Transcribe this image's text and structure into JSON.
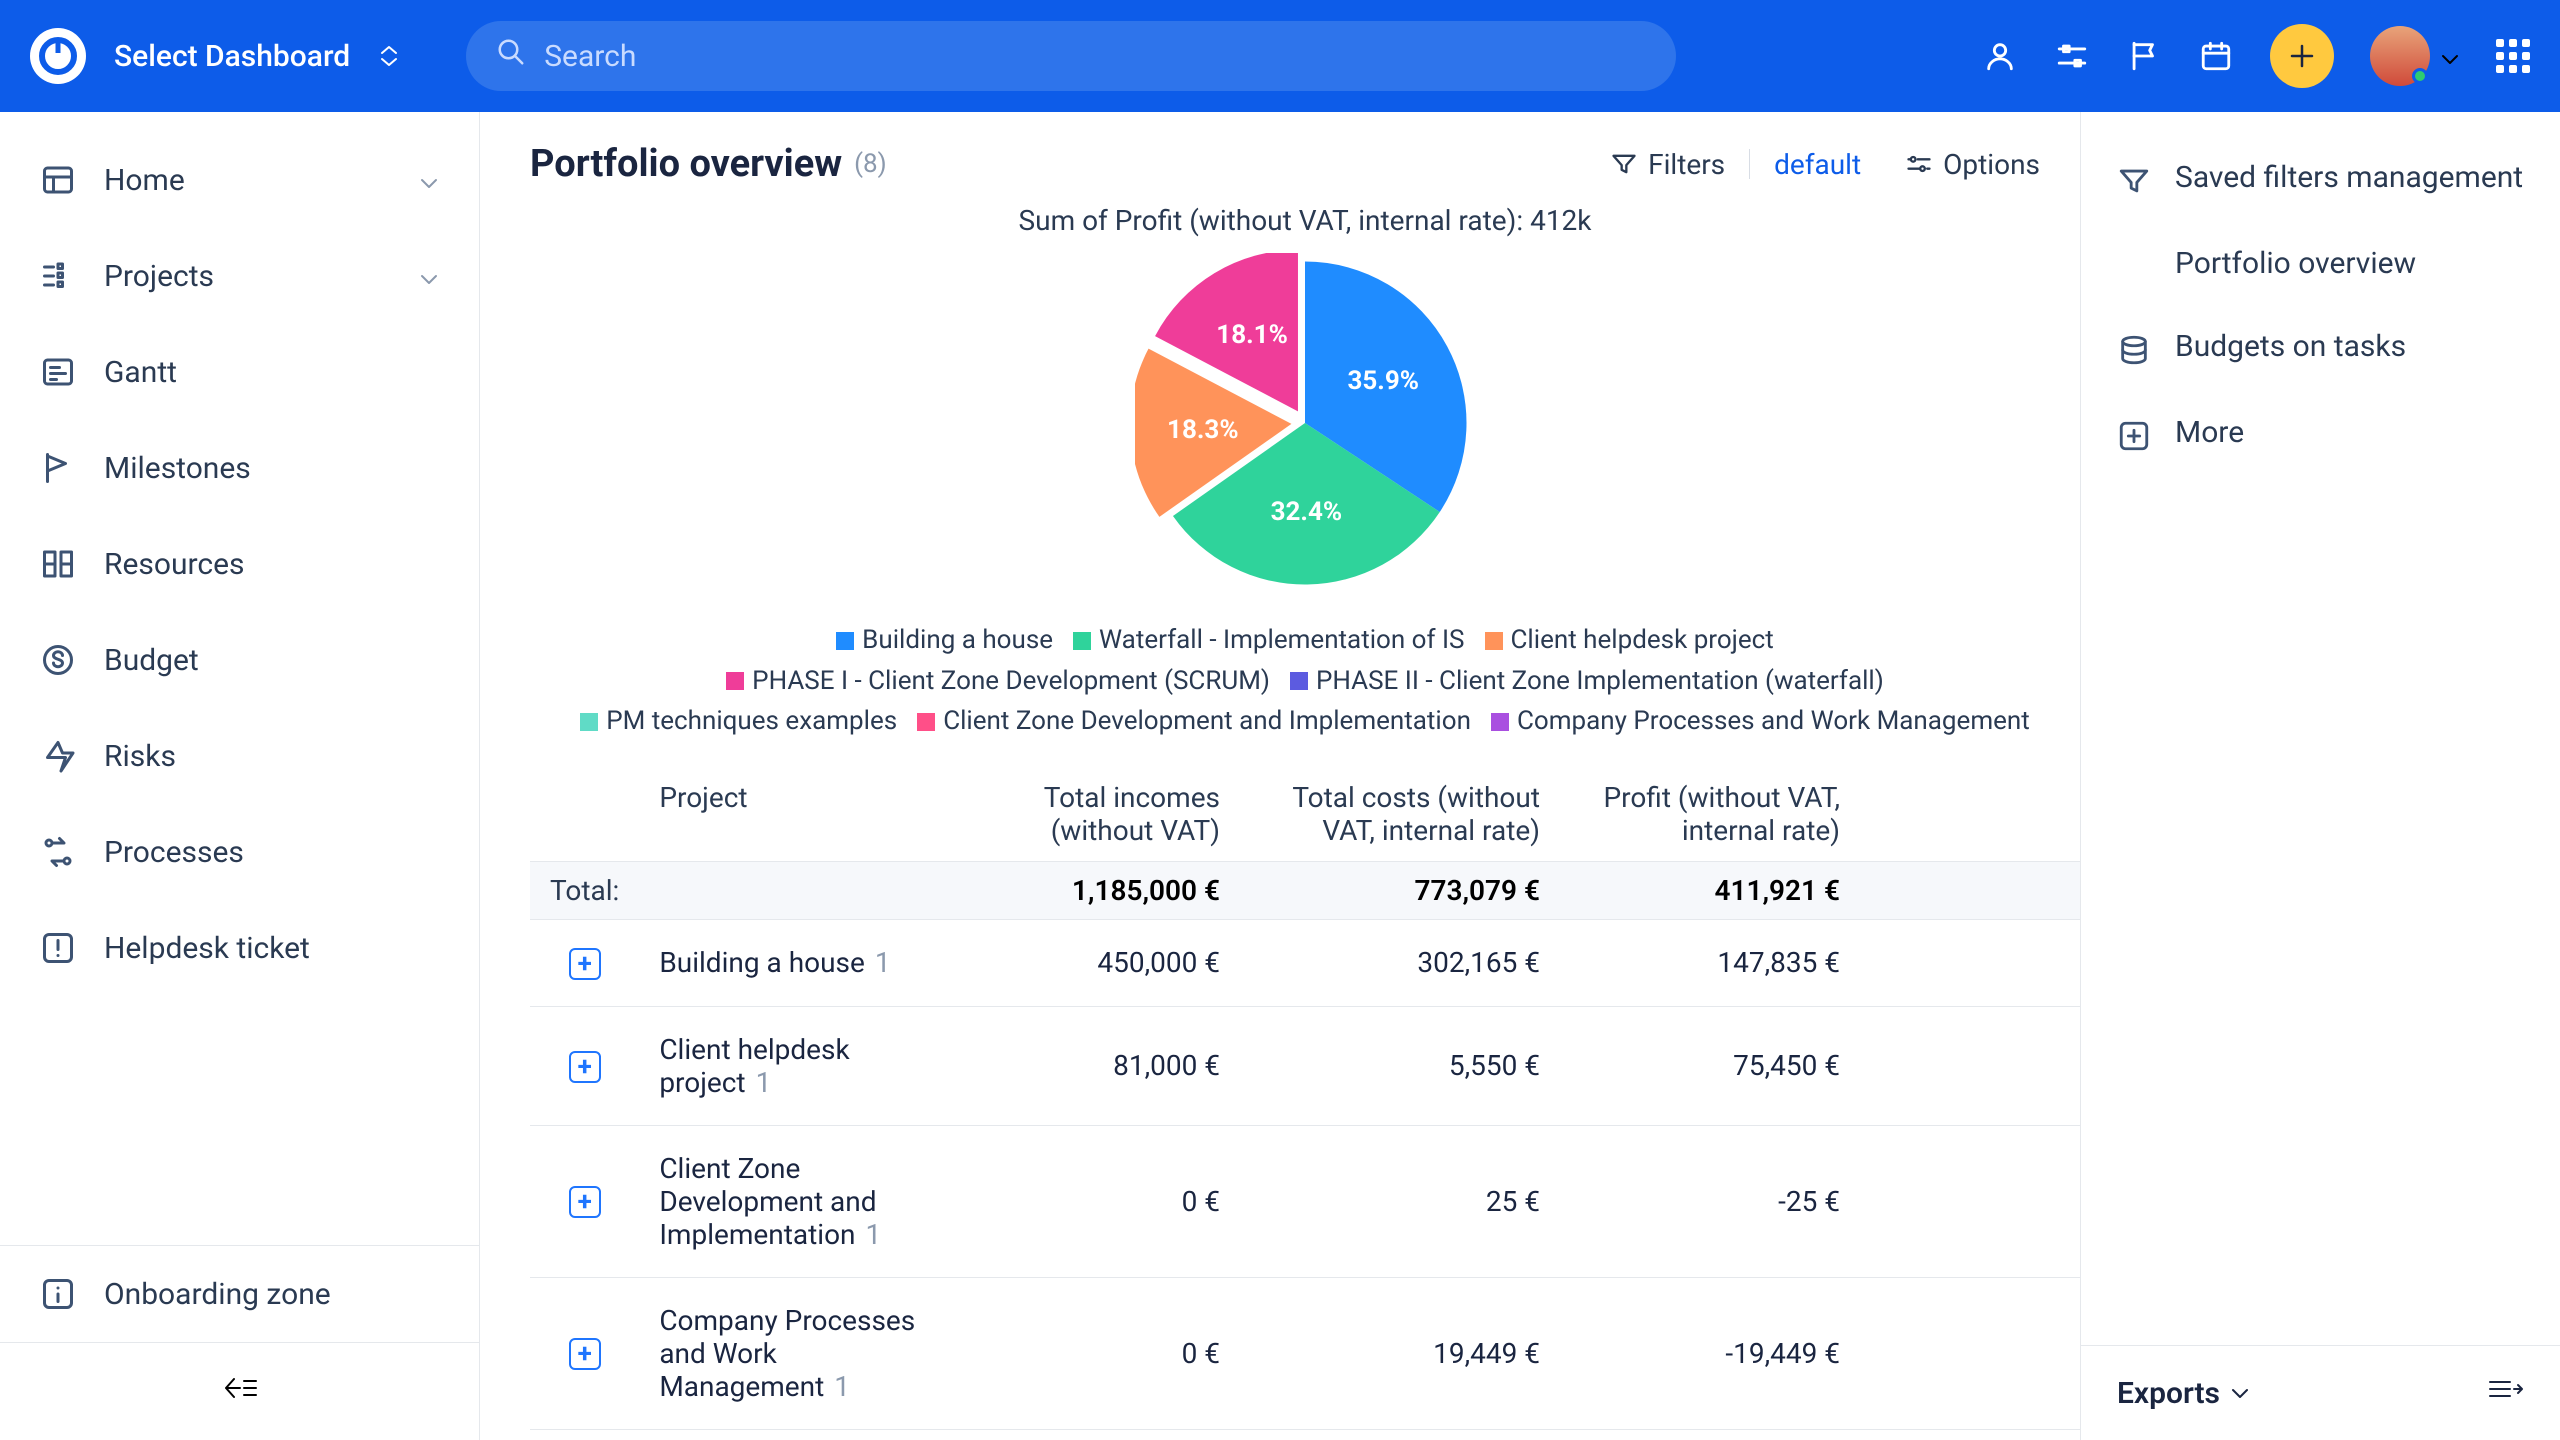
{
  "header": {
    "dashboard_selector": "Select Dashboard",
    "search_placeholder": "Search"
  },
  "sidebar": {
    "items": [
      {
        "label": "Home",
        "expandable": true
      },
      {
        "label": "Projects",
        "expandable": true
      },
      {
        "label": "Gantt",
        "expandable": false
      },
      {
        "label": "Milestones",
        "expandable": false
      },
      {
        "label": "Resources",
        "expandable": false
      },
      {
        "label": "Budget",
        "expandable": false
      },
      {
        "label": "Risks",
        "expandable": false
      },
      {
        "label": "Processes",
        "expandable": false
      },
      {
        "label": "Helpdesk ticket",
        "expandable": false
      }
    ],
    "onboarding": "Onboarding zone"
  },
  "main": {
    "title": "Portfolio overview",
    "count": "(8)",
    "filters_label": "Filters",
    "default_label": "default",
    "options_label": "Options",
    "chart_title": "Sum of Profit (without VAT, internal rate): 412k"
  },
  "chart_data": {
    "type": "pie",
    "title": "Sum of Profit (without VAT, internal rate): 412k",
    "series": [
      {
        "name": "Building a house",
        "value": 35.9,
        "percent_label": "35.9%",
        "color": "#1f8cff"
      },
      {
        "name": "Waterfall - Implementation of IS",
        "value": 32.4,
        "percent_label": "32.4%",
        "color": "#2fd39b"
      },
      {
        "name": "Client helpdesk project",
        "value": 18.3,
        "percent_label": "18.3%",
        "color": "#ff935a"
      },
      {
        "name": "PHASE I - Client Zone Development (SCRUM)",
        "value": 18.1,
        "percent_label": "18.1%",
        "color": "#ef3d99"
      },
      {
        "name": "PHASE II - Client Zone Implementation (waterfall)",
        "value": 0,
        "color": "#5c5be0"
      },
      {
        "name": "PM techniques examples",
        "value": 0,
        "color": "#60dbc6"
      },
      {
        "name": "Client Zone Development and Implementation",
        "value": 0,
        "color": "#ff4f88"
      },
      {
        "name": "Company Processes and Work Management",
        "value": 0,
        "color": "#a94fe0"
      }
    ]
  },
  "table": {
    "columns": [
      "Project",
      "Total incomes (without VAT)",
      "Total costs (without VAT, internal rate)",
      "Profit (without VAT, internal rate)"
    ],
    "total_label": "Total:",
    "totals": [
      "1,185,000 €",
      "773,079 €",
      "411,921 €"
    ],
    "rows": [
      {
        "project": "Building a house",
        "count": "1",
        "incomes": "450,000 €",
        "costs": "302,165 €",
        "profit": "147,835 €",
        "neg": false
      },
      {
        "project": "Client helpdesk project",
        "count": "1",
        "incomes": "81,000 €",
        "costs": "5,550 €",
        "profit": "75,450 €",
        "neg": false
      },
      {
        "project": "Client Zone Development and Implementation",
        "count": "1",
        "incomes": "0 €",
        "costs": "25 €",
        "profit": "-25 €",
        "neg": true
      },
      {
        "project": "Company Processes and Work Management",
        "count": "1",
        "incomes": "0 €",
        "costs": "19,449 €",
        "profit": "-19,449 €",
        "neg": true
      }
    ]
  },
  "rightpanel": {
    "saved_filters": "Saved filters management",
    "sub_item": "Portfolio overview",
    "budgets": "Budgets on tasks",
    "more": "More",
    "exports": "Exports"
  }
}
